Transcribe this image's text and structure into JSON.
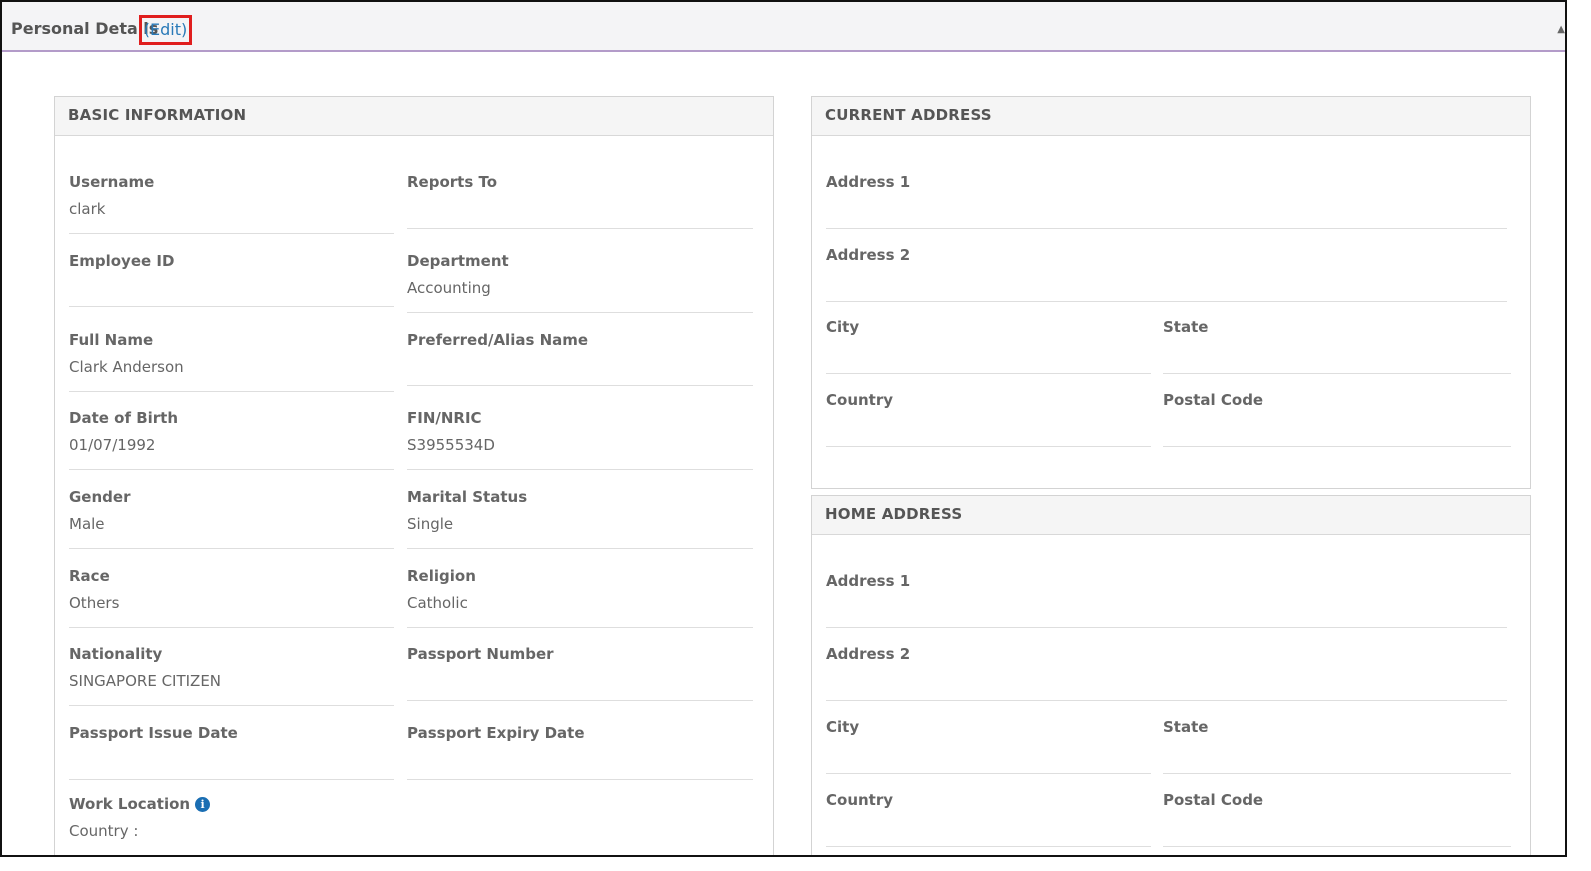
{
  "header": {
    "title": "Personal Details",
    "edit_label": "(Edit)"
  },
  "basic_info": {
    "title": "BASIC INFORMATION",
    "fields": [
      {
        "label": "Username",
        "value": "clark"
      },
      {
        "label": "Reports To",
        "value": ""
      },
      {
        "label": "Employee ID",
        "value": ""
      },
      {
        "label": "Department",
        "value": "Accounting"
      },
      {
        "label": "Full Name",
        "value": "Clark Anderson"
      },
      {
        "label": "Preferred/Alias Name",
        "value": ""
      },
      {
        "label": "Date of Birth",
        "value": "01/07/1992"
      },
      {
        "label": "FIN/NRIC",
        "value": "S3955534D"
      },
      {
        "label": "Gender",
        "value": "Male"
      },
      {
        "label": "Marital Status",
        "value": "Single"
      },
      {
        "label": "Race",
        "value": "Others"
      },
      {
        "label": "Religion",
        "value": "Catholic"
      },
      {
        "label": "Nationality",
        "value": "SINGAPORE CITIZEN"
      },
      {
        "label": "Passport Number",
        "value": ""
      },
      {
        "label": "Passport Issue Date",
        "value": ""
      },
      {
        "label": "Passport Expiry Date",
        "value": ""
      },
      {
        "label": "Work Location",
        "value": "Country :"
      }
    ]
  },
  "current_address": {
    "title": "CURRENT ADDRESS",
    "fields": [
      {
        "label": "Address 1",
        "value": ""
      },
      {
        "label": "Address 2",
        "value": ""
      },
      {
        "label": "City",
        "value": ""
      },
      {
        "label": "State",
        "value": ""
      },
      {
        "label": "Country",
        "value": ""
      },
      {
        "label": "Postal Code",
        "value": ""
      }
    ]
  },
  "home_address": {
    "title": "HOME ADDRESS",
    "fields": [
      {
        "label": "Address 1",
        "value": ""
      },
      {
        "label": "Address 2",
        "value": ""
      },
      {
        "label": "City",
        "value": ""
      },
      {
        "label": "State",
        "value": ""
      },
      {
        "label": "Country",
        "value": ""
      },
      {
        "label": "Postal Code",
        "value": ""
      }
    ]
  },
  "icons": {
    "work_location_info": "info-icon",
    "collapse": "chevron-up-icon"
  },
  "colors": {
    "link": "#2a7ab8",
    "highlight_box": "#e01e1e",
    "header_underline": "#b39bc9",
    "info_icon": "#1a6eb3"
  }
}
